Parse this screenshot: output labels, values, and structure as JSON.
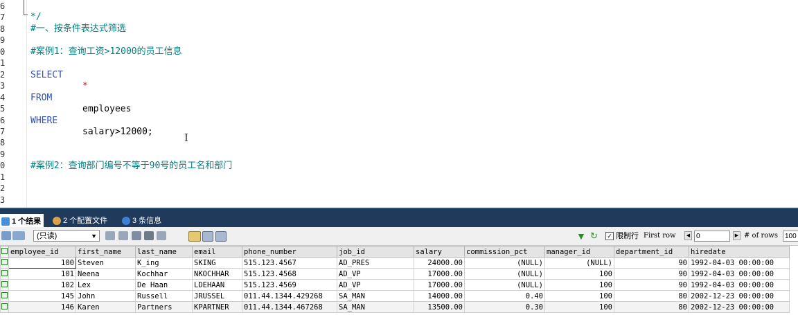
{
  "editor": {
    "line_numbers": [
      "6",
      "7",
      "8",
      "9",
      "0",
      "1",
      "2",
      "3",
      "4",
      "5",
      "6",
      "7",
      "8",
      "9",
      "0",
      "1",
      "2",
      "3"
    ],
    "lines": {
      "close_comment": "*/",
      "heading": "#一、按条件表达式筛选",
      "case1": "#案例1：查询工资>12000的员工信息",
      "select": "SELECT",
      "star": "*",
      "from": "FROM",
      "table": "employees",
      "where": "WHERE",
      "condition_col": "salary",
      "condition_op": ">12000;",
      "case2": "#案例2：查询部门编号不等于90号的员工名和部门"
    }
  },
  "tabs": [
    {
      "label": "1 个结果",
      "icon": "result-grid-icon",
      "active": true
    },
    {
      "label": "2 个配置文件",
      "icon": "profile-icon",
      "active": false
    },
    {
      "label": "3 条信息",
      "icon": "info-icon",
      "active": false
    }
  ],
  "toolbar": {
    "readonly_select": "(只读)",
    "limit_label": "限制行",
    "first_row_label": "First row",
    "first_row_value": "0",
    "rows_label": "# of rows",
    "rows_value": "100"
  },
  "grid": {
    "columns": [
      "employee_id",
      "first_name",
      "last_name",
      "email",
      "phone_number",
      "job_id",
      "salary",
      "commission_pct",
      "manager_id",
      "department_id",
      "hiredate"
    ],
    "rows": [
      [
        "100",
        "Steven",
        "K_ing",
        "SKING",
        "515.123.4567",
        "AD_PRES",
        "24000.00",
        "(NULL)",
        "(NULL)",
        "90",
        "1992-04-03 00:00:00"
      ],
      [
        "101",
        "Neena",
        "Kochhar",
        "NKOCHHAR",
        "515.123.4568",
        "AD_VP",
        "17000.00",
        "(NULL)",
        "100",
        "90",
        "1992-04-03 00:00:00"
      ],
      [
        "102",
        "Lex",
        "De Haan",
        "LDEHAAN",
        "515.123.4569",
        "AD_VP",
        "17000.00",
        "(NULL)",
        "100",
        "90",
        "1992-04-03 00:00:00"
      ],
      [
        "145",
        "John",
        "Russell",
        "JRUSSEL",
        "011.44.1344.429268",
        "SA_MAN",
        "14000.00",
        "0.40",
        "100",
        "80",
        "2002-12-23 00:00:00"
      ],
      [
        "146",
        "Karen",
        "Partners",
        "KPARTNER",
        "011.44.1344.467268",
        "SA_MAN",
        "13500.00",
        "0.30",
        "100",
        "80",
        "2002-12-23 00:00:00"
      ]
    ]
  },
  "colors": {
    "comment": "#008080",
    "keyword": "#2f4fb5",
    "tabbar": "#1f3a5a"
  }
}
